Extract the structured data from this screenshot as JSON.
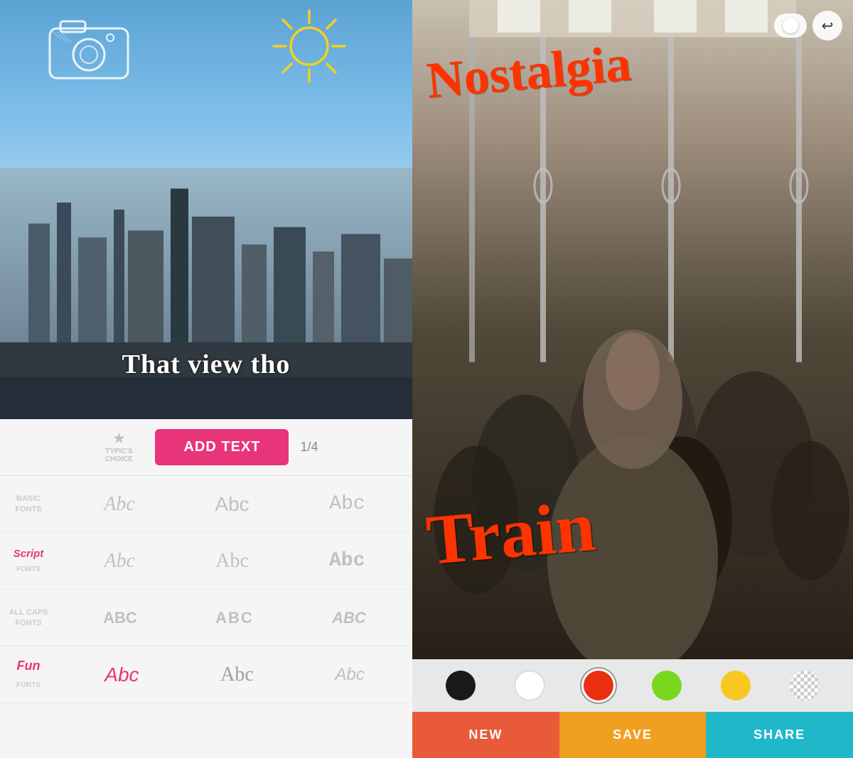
{
  "leftPanel": {
    "photoText": "That view tho",
    "addTextButton": "ADD TEXT",
    "pageIndicator": "1/4",
    "typicsChoice": {
      "star": "★",
      "line1": "TYPIC'S",
      "line2": "CHOICE"
    },
    "fontCategories": [
      {
        "id": "basic",
        "label": "BASIC\nFONTS",
        "samples": [
          "Abc",
          "Abc",
          "Abc"
        ]
      },
      {
        "id": "script",
        "label": "Script\nFONTS",
        "samples": [
          "Abc",
          "Abc",
          "Abc"
        ]
      },
      {
        "id": "allcaps",
        "label": "ALL CAPS\nFONTS",
        "samples": [
          "Abc",
          "ABC",
          "Abc"
        ]
      },
      {
        "id": "fun",
        "label": "Fun\nFONTS",
        "samples": [
          "Abc",
          "Abc",
          "Abc"
        ]
      }
    ]
  },
  "rightPanel": {
    "overlayTextNostalgia": "Nostalgia",
    "overlayTextTrain": "Train",
    "colorPalette": [
      {
        "id": "black",
        "color": "#1a1a1a",
        "selected": false
      },
      {
        "id": "white",
        "color": "#ffffff",
        "selected": false
      },
      {
        "id": "red",
        "color": "#e83010",
        "selected": true
      },
      {
        "id": "green",
        "color": "#78d820",
        "selected": false
      },
      {
        "id": "yellow",
        "color": "#f8c820",
        "selected": false
      },
      {
        "id": "checker",
        "color": "checker",
        "selected": false
      }
    ],
    "actionButtons": {
      "new": "NEW",
      "save": "SAVE",
      "share": "SHARE"
    }
  }
}
